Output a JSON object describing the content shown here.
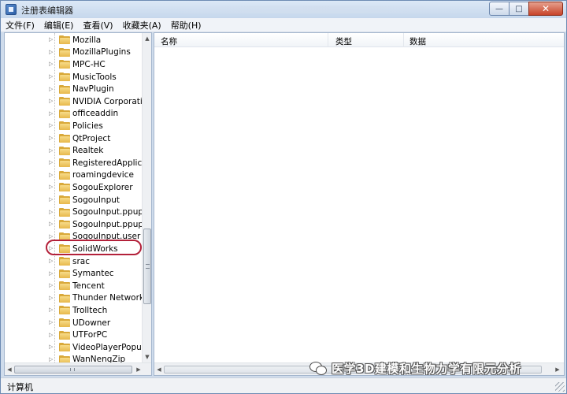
{
  "window": {
    "title": "注册表编辑器",
    "minimize_glyph": "—",
    "maximize_glyph": "□",
    "close_glyph": "✕"
  },
  "menu": [
    {
      "label": "文件(F)"
    },
    {
      "label": "编辑(E)"
    },
    {
      "label": "查看(V)"
    },
    {
      "label": "收藏夹(A)"
    },
    {
      "label": "帮助(H)"
    }
  ],
  "tree": {
    "items": [
      {
        "label": "Mozilla",
        "icon": "folder-icon"
      },
      {
        "label": "MozillaPlugins",
        "icon": "folder-icon"
      },
      {
        "label": "MPC-HC",
        "icon": "folder-icon"
      },
      {
        "label": "MusicTools",
        "icon": "folder-icon"
      },
      {
        "label": "NavPlugin",
        "icon": "folder-icon"
      },
      {
        "label": "NVIDIA Corporation",
        "icon": "folder-icon"
      },
      {
        "label": "officeaddin",
        "icon": "folder-icon"
      },
      {
        "label": "Policies",
        "icon": "folder-icon"
      },
      {
        "label": "QtProject",
        "icon": "folder-icon"
      },
      {
        "label": "Realtek",
        "icon": "folder-icon"
      },
      {
        "label": "RegisteredApplicatio",
        "icon": "folder-icon"
      },
      {
        "label": "roamingdevice",
        "icon": "folder-icon"
      },
      {
        "label": "SogouExplorer",
        "icon": "folder-icon"
      },
      {
        "label": "SogouInput",
        "icon": "folder-icon"
      },
      {
        "label": "SogouInput.ppup",
        "icon": "folder-icon"
      },
      {
        "label": "SogouInput.ppup.us",
        "icon": "folder-icon"
      },
      {
        "label": "SogouInput.user",
        "icon": "folder-icon"
      },
      {
        "label": "SolidWorks",
        "icon": "folder-icon",
        "highlighted": true
      },
      {
        "label": "srac",
        "icon": "folder-icon"
      },
      {
        "label": "Symantec",
        "icon": "folder-icon"
      },
      {
        "label": "Tencent",
        "icon": "folder-icon"
      },
      {
        "label": "Thunder Network",
        "icon": "folder-icon"
      },
      {
        "label": "Trolltech",
        "icon": "folder-icon"
      },
      {
        "label": "UDowner",
        "icon": "folder-icon"
      },
      {
        "label": "UTForPC",
        "icon": "folder-icon"
      },
      {
        "label": "VideoPlayerPopup",
        "icon": "folder-icon"
      },
      {
        "label": "WanNengZip",
        "icon": "folder-icon"
      }
    ],
    "highlight_color": "#b3213a"
  },
  "list": {
    "columns": [
      {
        "label": "名称"
      },
      {
        "label": "类型"
      },
      {
        "label": "数据"
      }
    ]
  },
  "watermark": {
    "text": "医学3D建模和生物力学有限元分析",
    "icon": "wechat-icon"
  },
  "status": {
    "path": "计算机"
  },
  "colors": {
    "folder": "#e7b84b",
    "window_frame": "#cfdcec",
    "close_button": "#c8442a"
  }
}
